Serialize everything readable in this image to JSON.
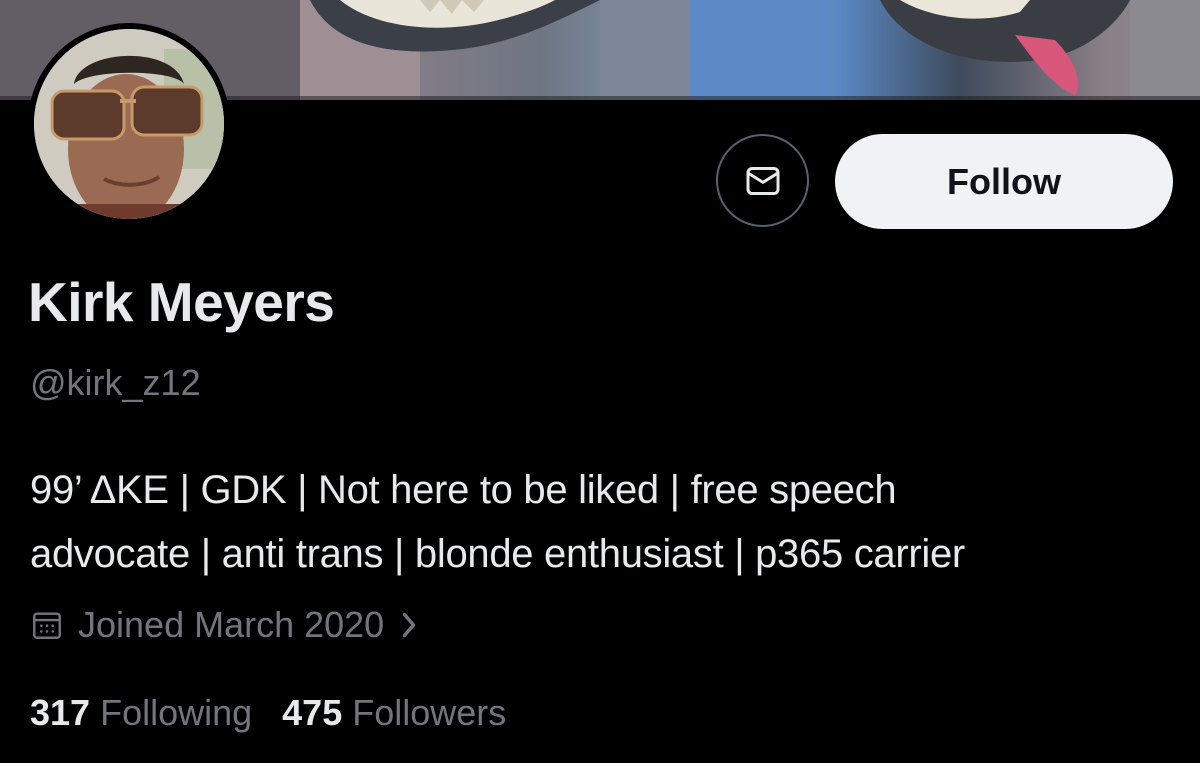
{
  "profile": {
    "display_name": "Kirk Meyers",
    "handle": "@kirk_z12",
    "bio_lines": [
      "99’ ΔKE | GDK | Not here to be liked | free speech",
      "advocate | anti trans | blonde enthusiast | p365 carrier"
    ],
    "joined": "Joined March 2020"
  },
  "actions": {
    "message_icon": "envelope-icon",
    "follow_label": "Follow"
  },
  "stats": {
    "following_count": "317",
    "following_label": "Following",
    "followers_count": "475",
    "followers_label": "Followers"
  },
  "icons": {
    "joined": "calendar-icon",
    "joined_more": "chevron-right-icon"
  },
  "colors": {
    "background": "#000000",
    "primary_text": "#e7e9ea",
    "secondary_text": "#71767b",
    "follow_button_bg": "#eff3f4",
    "button_border": "#536471"
  }
}
